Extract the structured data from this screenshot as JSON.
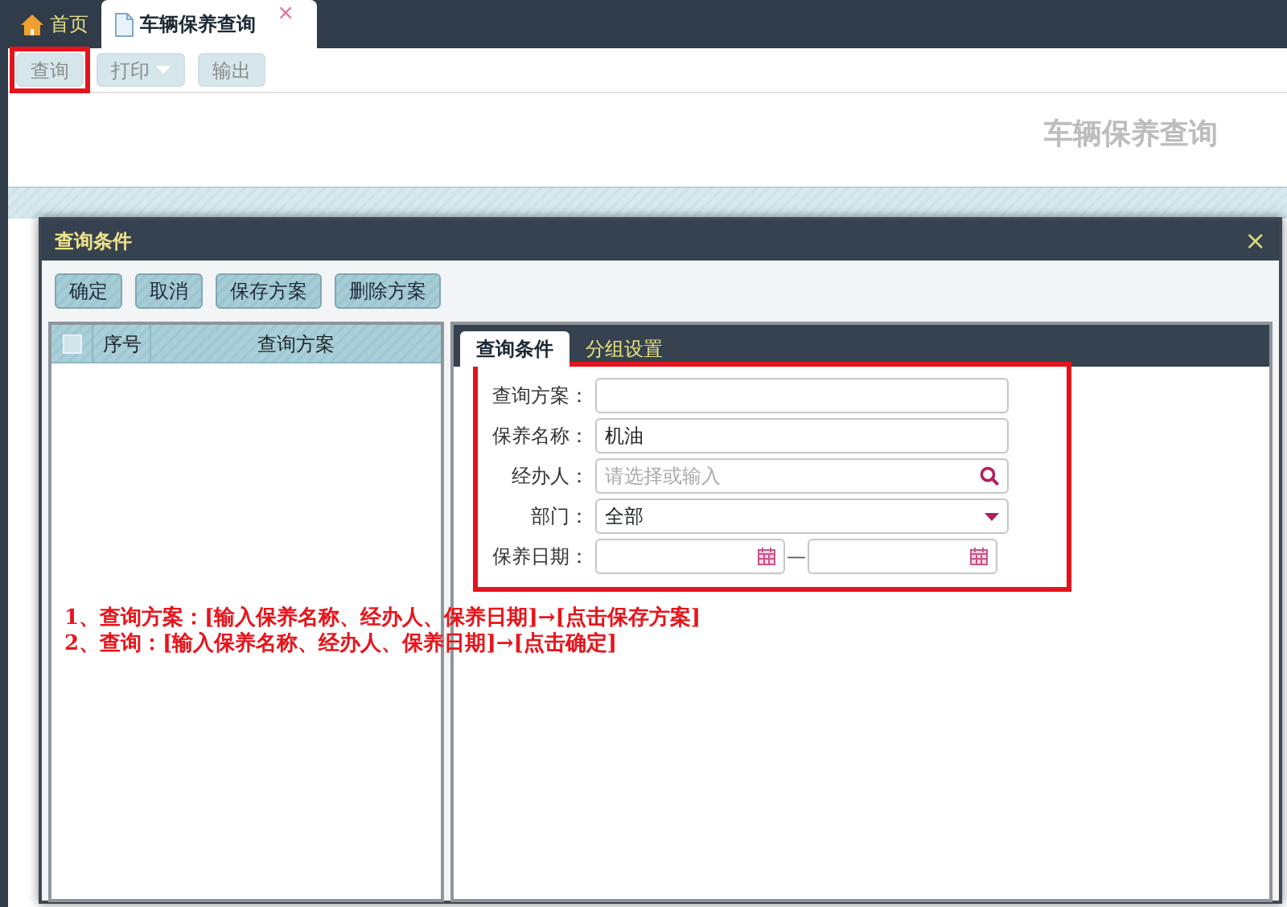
{
  "tabs": [
    {
      "label": "首页",
      "kind": "home",
      "selected": false
    },
    {
      "label": "车辆保养查询",
      "kind": "document",
      "selected": true,
      "close": "×"
    }
  ],
  "toolbar": [
    {
      "label": "查询",
      "highlighted": true,
      "dropdown": false
    },
    {
      "label": "打印",
      "highlighted": false,
      "dropdown": true
    },
    {
      "label": "输出",
      "highlighted": false,
      "dropdown": false
    }
  ],
  "page_title": "车辆保养查询",
  "dialog": {
    "title": "查询条件",
    "close": "×",
    "buttons": [
      "确定",
      "取消",
      "保存方案",
      "删除方案"
    ],
    "scheme_list": {
      "select_all_checked": false,
      "columns": [
        "序号",
        "查询方案"
      ]
    },
    "tabs": [
      {
        "label": "查询条件",
        "selected": true
      },
      {
        "label": "分组设置",
        "selected": false
      }
    ],
    "form_highlighted": true,
    "fields": [
      {
        "label": "查询方案：",
        "kind": "text"
      },
      {
        "label": "保养名称：",
        "kind": "text",
        "value": "机油"
      },
      {
        "label": "经办人：",
        "kind": "search",
        "placeholder": "请选择或输入"
      },
      {
        "label": "部门：",
        "kind": "select",
        "value": "全部"
      },
      {
        "label": "保养日期：",
        "kind": "daterange",
        "separator": "—"
      }
    ],
    "annotations": [
      "1、查询方案：[输入保养名称、经办人、保养日期]→[点击保存方案]",
      "2、查询：[输入保养名称、经办人、保养日期]→[点击确定]"
    ]
  }
}
